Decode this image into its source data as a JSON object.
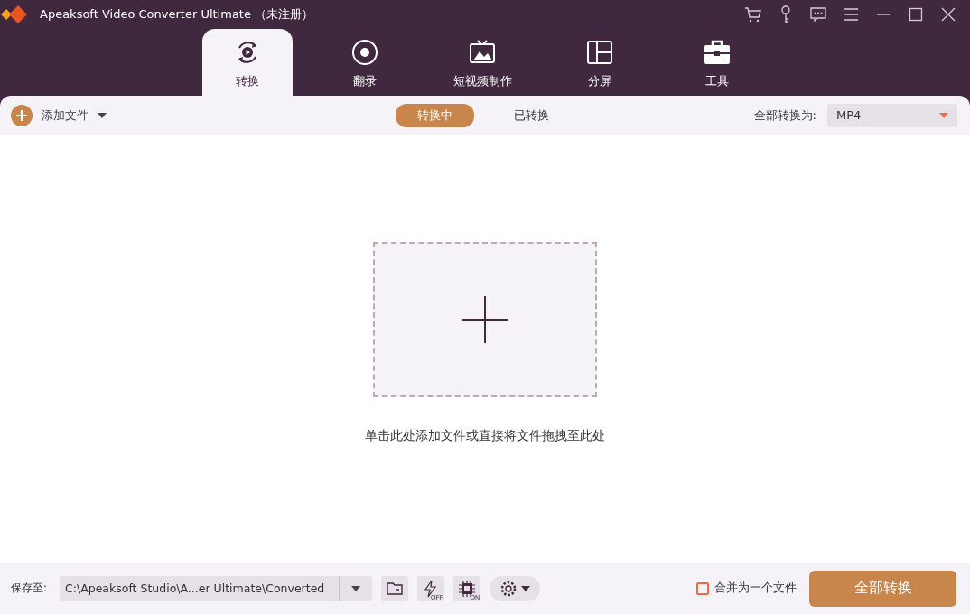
{
  "window": {
    "title": "Apeaksoft Video Converter Ultimate （未注册）"
  },
  "tabs": [
    {
      "label": "转换",
      "selected": true
    },
    {
      "label": "翻录",
      "selected": false
    },
    {
      "label": "短视频制作",
      "selected": false
    },
    {
      "label": "分屏",
      "selected": false
    },
    {
      "label": "工具",
      "selected": false
    }
  ],
  "toolbar": {
    "add_files": "添加文件",
    "segments": [
      {
        "label": "转换中",
        "selected": true
      },
      {
        "label": "已转换",
        "selected": false
      }
    ],
    "convert_all_label": "全部转换为:",
    "format": "MP4"
  },
  "drop_zone": {
    "hint": "单击此处添加文件或直接将文件拖拽至此处"
  },
  "footer": {
    "save_label": "保存至:",
    "path": "C:\\Apeaksoft Studio\\A...er Ultimate\\Converted",
    "speed_badge": "OFF",
    "hw_badge": "ON",
    "merge": {
      "label": "合并为一个文件",
      "checked": false
    },
    "convert_button": "全部转换"
  }
}
